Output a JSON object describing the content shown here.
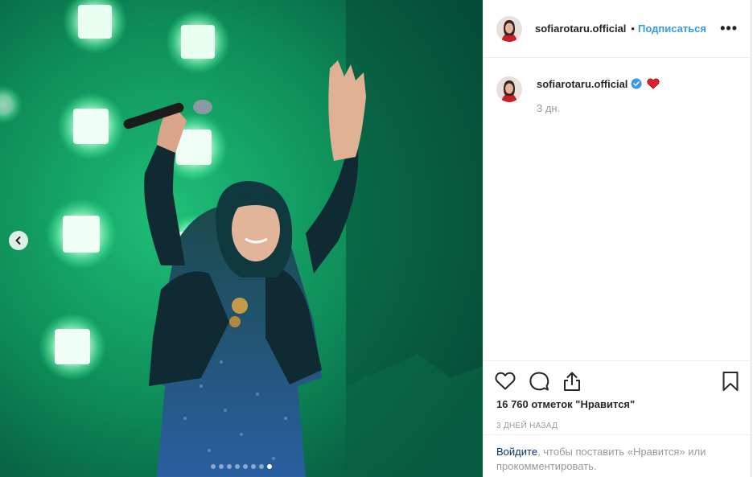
{
  "header": {
    "username": "sofiarotaru.official",
    "separator": "•",
    "follow_label": "Подписаться",
    "more_label": "•••"
  },
  "comment": {
    "username": "sofiarotaru.official",
    "verified_icon": "verified-badge-icon",
    "emoji_icon": "red-heart-icon",
    "time": "3 дн."
  },
  "actions": {
    "icons": [
      "heart-icon",
      "comment-icon",
      "share-icon",
      "bookmark-icon"
    ],
    "likes": "16 760 отметок \"Нравится\"",
    "posted_ago": "3 ДНЕЙ НАЗАД"
  },
  "login": {
    "link": "Войдите",
    "rest": ", чтобы поставить «Нравится» или прокомментировать."
  },
  "carousel": {
    "prev_icon": "chevron-left-icon",
    "total_slides": 8,
    "active_slide": 8
  },
  "colors": {
    "link_blue": "#3897f0",
    "verified_blue": "#3897f0",
    "heart_red": "#ed4956",
    "stage_green": "#1db66a"
  }
}
